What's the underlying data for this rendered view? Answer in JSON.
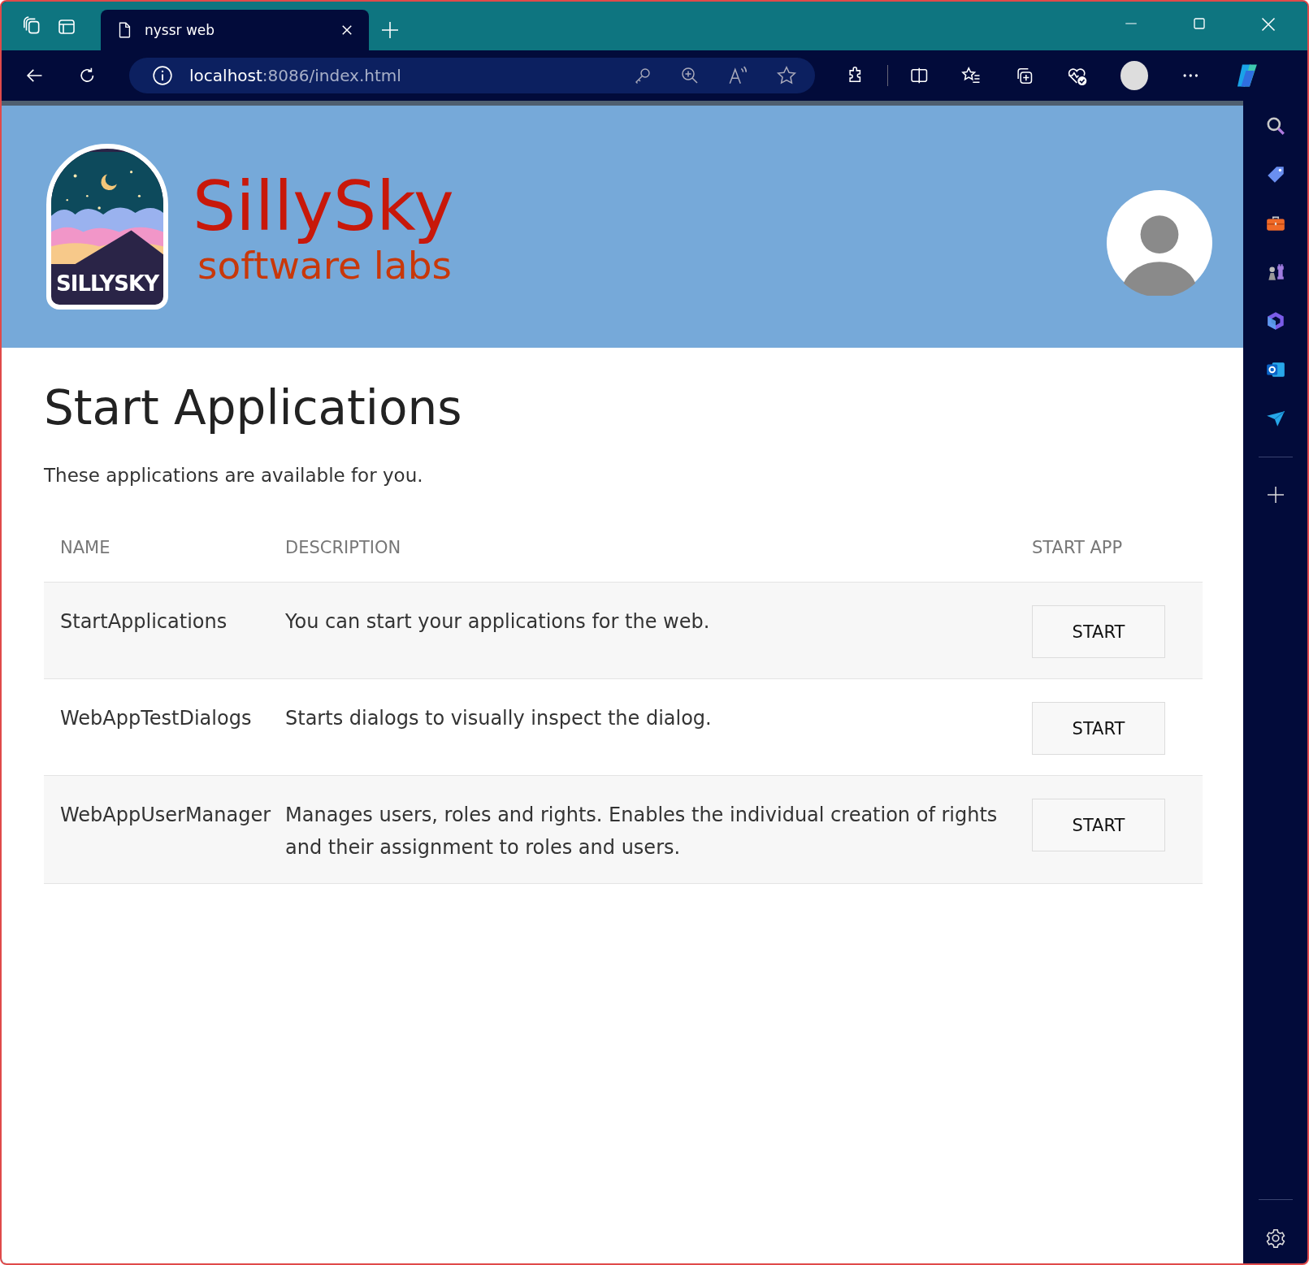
{
  "browser": {
    "tabs": [
      {
        "title": "nyssr web",
        "selected": true
      }
    ],
    "address": {
      "host": "localhost",
      "path": ":8086/index.html"
    }
  },
  "header": {
    "badge_text": "SILLYSKY",
    "brand": "SillySky",
    "tagline": "software labs"
  },
  "page": {
    "title": "Start Applications",
    "intro": "These applications are available for you.",
    "columns": [
      "NAME",
      "DESCRIPTION",
      "START APP"
    ],
    "rows": [
      {
        "name": "StartApplications",
        "description": "You can start your applications for the web.",
        "action": "START"
      },
      {
        "name": "WebAppTestDialogs",
        "description": "Starts dialogs to visually inspect the dialog.",
        "action": "START"
      },
      {
        "name": "WebAppUserManager",
        "description": "Manages users, roles and rights. Enables the individual creation of rights and their assignment to roles and users.",
        "action": "START"
      }
    ]
  }
}
